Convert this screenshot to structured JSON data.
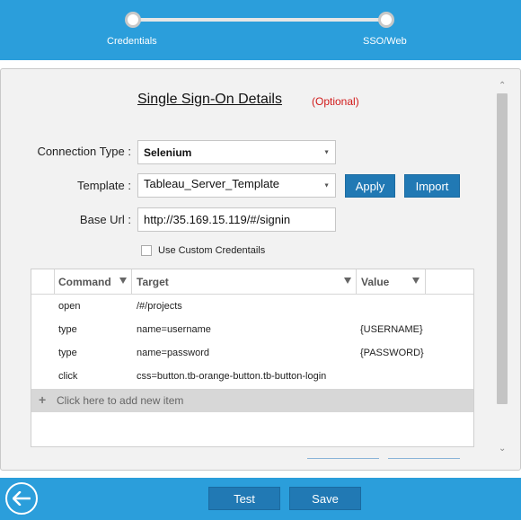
{
  "wizard": {
    "steps": [
      {
        "label": "Credentials"
      },
      {
        "label": "SSO/Web"
      }
    ]
  },
  "form": {
    "title": "Single Sign-On Details",
    "optional": "(Optional)",
    "connection_type_label": "Connection Type :",
    "connection_type_value": "Selenium",
    "template_label": "Template :",
    "template_value": "Tableau_Server_Template",
    "apply_label": "Apply",
    "import_label": "Import",
    "base_url_label": "Base Url :",
    "base_url_value": "http://35.169.15.119/#/signin",
    "custom_credentials_label": "Use Custom Credentails"
  },
  "grid": {
    "columns": [
      "Command",
      "Target",
      "Value"
    ],
    "rows": [
      {
        "command": "open",
        "target": "/#/projects",
        "value": ""
      },
      {
        "command": "type",
        "target": "name=username",
        "value": "{USERNAME}"
      },
      {
        "command": "type",
        "target": "name=password",
        "value": "{PASSWORD}"
      },
      {
        "command": "click",
        "target": "css=button.tb-orange-button.tb-button-login",
        "value": ""
      }
    ],
    "add_item_label": "Click here to add new item"
  },
  "footer": {
    "test_label": "Test",
    "save_label": "Save"
  },
  "colors": {
    "header_blue": "#2b9edb",
    "button_blue": "#2179b4",
    "optional_red": "#d11a1a"
  }
}
